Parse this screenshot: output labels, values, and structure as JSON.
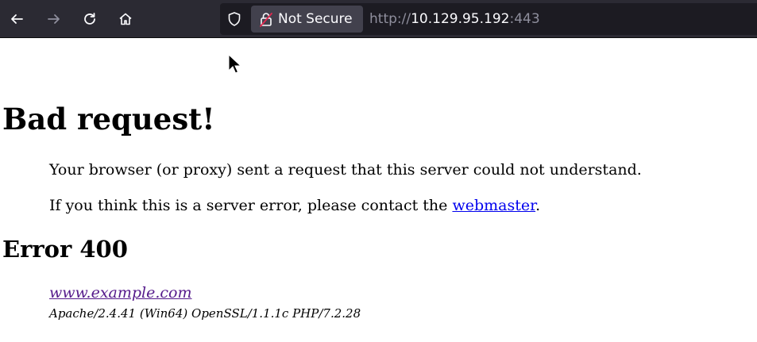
{
  "browser": {
    "back_icon": "back-arrow-icon",
    "forward_icon": "forward-arrow-icon",
    "reload_icon": "reload-icon",
    "home_icon": "home-icon",
    "tracking_icon": "shield-icon",
    "security_label": "Not Secure",
    "url_scheme": "http://",
    "url_host": "10.129.95.192",
    "url_port": ":443"
  },
  "page": {
    "title": "Bad request!",
    "message": "Your browser (or proxy) sent a request that this server could not understand.",
    "contact_prefix": "If you think this is a server error, please contact the ",
    "contact_link": "webmaster",
    "contact_suffix": ".",
    "error_heading": "Error 400",
    "address_link": "www.example.com",
    "server_signature": "Apache/2.4.41 (Win64) OpenSSL/1.1.1c PHP/7.2.28"
  },
  "colors": {
    "toolbar_bg": "#2b2a33",
    "urlbar_bg": "#1c1b22",
    "link": "#0000ee",
    "visited_link": "#551a8b"
  }
}
